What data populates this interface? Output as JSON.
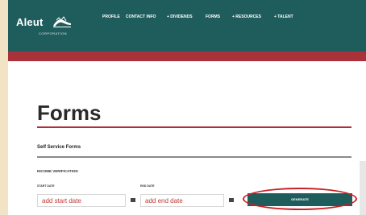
{
  "header": {
    "logo_name": "Aleut",
    "logo_sub": "CORPORATION",
    "nav": [
      {
        "label": "PROFILE"
      },
      {
        "label": "CONTACT INFO"
      },
      {
        "label": "+ DIVIDENDS"
      },
      {
        "label": "FORMS"
      },
      {
        "label": "+ RESOURCES"
      },
      {
        "label": "+ TALENT"
      }
    ]
  },
  "main": {
    "title": "Forms",
    "section": "Self Service Forms",
    "subsection": "INCOME VERIFICATION",
    "start_label": "START DATE",
    "start_placeholder": "add start date",
    "end_label": "END DATE",
    "end_placeholder": "add end date",
    "generate_label": "GENERATE"
  },
  "colors": {
    "header_teal": "#1f5c5c",
    "brand_red": "#a9323b",
    "highlight_red": "#cc1f24"
  },
  "icons": [
    "seal-icon",
    "calendar-icon"
  ]
}
